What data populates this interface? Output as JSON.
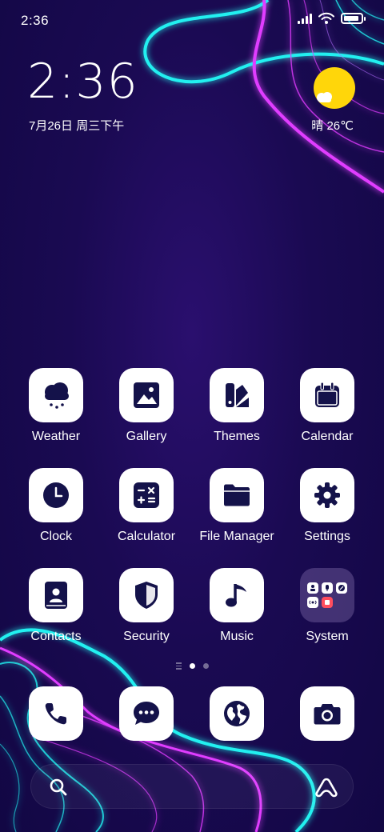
{
  "status_bar": {
    "time": "2:36",
    "battery_level": 0.9
  },
  "clock_widget": {
    "time": "2:36",
    "date": "7月26日 周三下午"
  },
  "weather_widget": {
    "condition": "晴",
    "temperature": "26℃",
    "text": "晴 26℃"
  },
  "apps": [
    {
      "label": "Weather",
      "icon": "cloud-snow-icon"
    },
    {
      "label": "Gallery",
      "icon": "image-icon"
    },
    {
      "label": "Themes",
      "icon": "theme-brush-icon"
    },
    {
      "label": "Calendar",
      "icon": "calendar-icon"
    },
    {
      "label": "Clock",
      "icon": "clock-icon"
    },
    {
      "label": "Calculator",
      "icon": "calculator-icon"
    },
    {
      "label": "File Manager",
      "icon": "folder-icon"
    },
    {
      "label": "Settings",
      "icon": "gear-icon"
    },
    {
      "label": "Contacts",
      "icon": "contact-book-icon"
    },
    {
      "label": "Security",
      "icon": "shield-icon"
    },
    {
      "label": "Music",
      "icon": "music-note-icon"
    },
    {
      "label": "System",
      "icon": "app-folder-icon"
    }
  ],
  "dock": [
    {
      "name": "phone",
      "icon": "phone-icon"
    },
    {
      "name": "messages",
      "icon": "chat-bubble-icon"
    },
    {
      "name": "browser",
      "icon": "globe-icon"
    },
    {
      "name": "camera",
      "icon": "camera-icon"
    }
  ],
  "pager": {
    "pages": 2,
    "current": 1
  },
  "colors": {
    "icon_fg": "#14124a",
    "neon_cyan": "#22f0f0",
    "neon_magenta": "#e03cff",
    "sun": "#ffd60a",
    "bg": "#1a0a52"
  }
}
